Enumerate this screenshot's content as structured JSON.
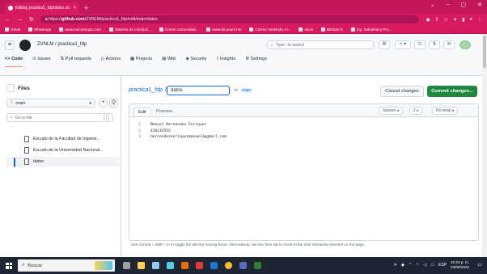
{
  "browser": {
    "tab_title": "Editing practica1_fdp/datos at m",
    "tab_close": "×",
    "new_tab": "+",
    "window_controls": [
      "⌄",
      "–",
      "▢",
      "✕"
    ],
    "url_prefix": "https://",
    "url_host": "github.com",
    "url_path": "/ZVNLM/practica1_fdp/edit/main/datos",
    "bookmarks": [
      "Gmail",
      "WhatsApp",
      "www.mecomcgm.com",
      "Sistema de Inscripci...",
      "Correo comunidad...",
      "www.ds.unam.mx",
      "Correo: MANUEL H...",
      "Inicio",
      "Bibliote R",
      "Ing. Industrial y Pro..."
    ]
  },
  "gh": {
    "repo_path": "ZVNLM / practica1_fdp",
    "search_placeholder": "Type / to search",
    "nav": [
      "Code",
      "Issues",
      "Pull requests",
      "Actions",
      "Projects",
      "Wiki",
      "Security",
      "Insights",
      "Settings"
    ],
    "header_buttons": [
      "⌘",
      "+ ▾",
      "⊙",
      "⇅",
      "✉"
    ]
  },
  "files": {
    "title": "Files",
    "branch": "main",
    "add": "+",
    "search_btn": "Q",
    "goto_placeholder": "Go to file",
    "goto_key": "t",
    "items": [
      "Escudo de la Facultad de Ingenie...",
      "Escudo de la Universidad Nacional...",
      "datos"
    ]
  },
  "editor": {
    "crumb_repo": "practica1_fdp",
    "crumb_sep": "/",
    "filename": "datos",
    "in_label": "in",
    "branch_tag": "main",
    "cancel": "Cancel changes",
    "commit": "Commit changes...",
    "tab_edit": "Edit",
    "tab_preview": "Preview",
    "indent_mode": "Spaces",
    "indent_size": "2",
    "wrap": "No wrap",
    "lines": [
      {
        "n": "1",
        "text": "Manuel Hernández Enríquez"
      },
      {
        "n": "2",
        "text": "420143555"
      },
      {
        "n": "3",
        "text": "hernandezenriquezmanuel1@gmail.com"
      }
    ],
    "hint": "Use Control + Shift + m to toggle the tab key moving focus. Alternatively, use esc then tab to move to the next interactive element on the page."
  },
  "taskbar": {
    "search": "Buscar",
    "time": "10:24 p. m.",
    "date": "23/08/2023",
    "lang": "ESP"
  },
  "colors": {
    "browser_accent": "#d81b60",
    "commit_green": "#1f883d",
    "link_blue": "#0969da"
  }
}
